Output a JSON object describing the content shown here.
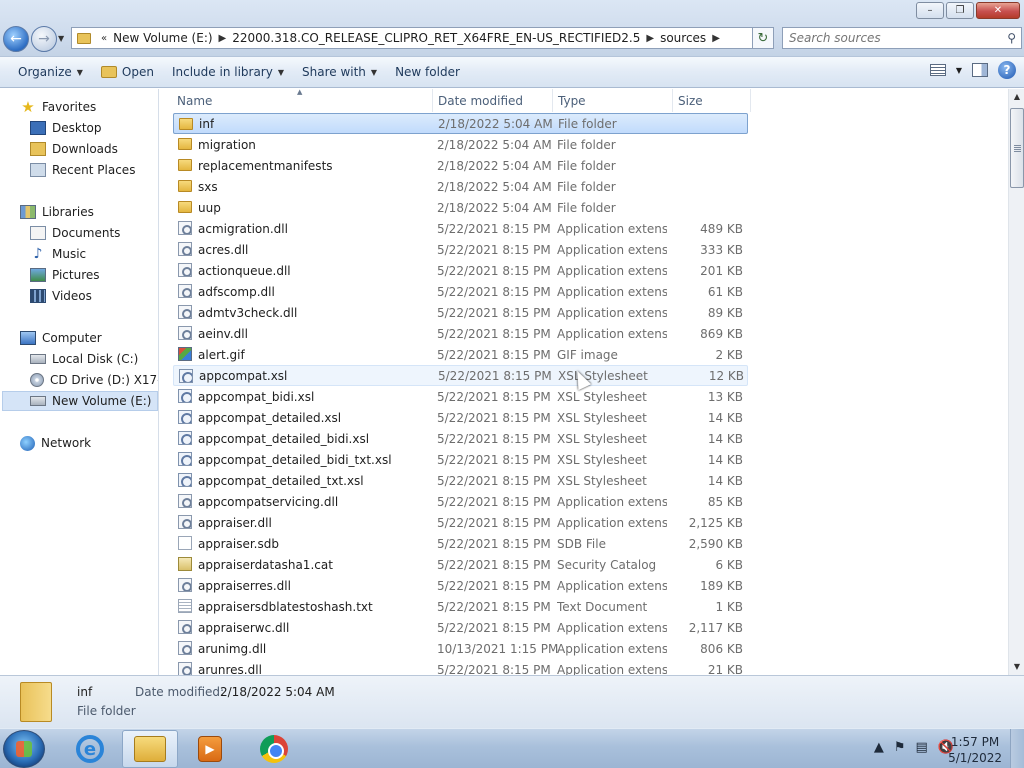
{
  "window": {
    "min_icon": "minimize-icon",
    "max_icon": "maximize-icon",
    "close_icon": "close-icon"
  },
  "address": {
    "crumbs": [
      "New Volume (E:)",
      "22000.318.CO_RELEASE_CLIPRO_RET_X64FRE_EN-US_RECTIFIED2.5",
      "sources"
    ],
    "overflow_glyph": "«"
  },
  "search": {
    "placeholder": "Search sources"
  },
  "toolbar": {
    "organize": "Organize",
    "open": "Open",
    "include_in_library": "Include in library",
    "share_with": "Share with",
    "new_folder": "New folder"
  },
  "nav": {
    "favorites": "Favorites",
    "desktop": "Desktop",
    "downloads": "Downloads",
    "recent_places": "Recent Places",
    "libraries": "Libraries",
    "documents": "Documents",
    "music": "Music",
    "pictures": "Pictures",
    "videos": "Videos",
    "computer": "Computer",
    "local_disk": "Local Disk (C:)",
    "cd_drive": "CD Drive (D:) X17-59",
    "new_volume": "New Volume (E:)",
    "network": "Network"
  },
  "columns": {
    "name": "Name",
    "date_modified": "Date modified",
    "type": "Type",
    "size": "Size"
  },
  "files": [
    {
      "name": "inf",
      "date": "2/18/2022 5:04 AM",
      "type": "File folder",
      "size": "",
      "icon": "folder-icon"
    },
    {
      "name": "migration",
      "date": "2/18/2022 5:04 AM",
      "type": "File folder",
      "size": "",
      "icon": "folder-icon"
    },
    {
      "name": "replacementmanifests",
      "date": "2/18/2022 5:04 AM",
      "type": "File folder",
      "size": "",
      "icon": "folder-icon"
    },
    {
      "name": "sxs",
      "date": "2/18/2022 5:04 AM",
      "type": "File folder",
      "size": "",
      "icon": "folder-icon"
    },
    {
      "name": "uup",
      "date": "2/18/2022 5:04 AM",
      "type": "File folder",
      "size": "",
      "icon": "folder-icon"
    },
    {
      "name": "acmigration.dll",
      "date": "5/22/2021 8:15 PM",
      "type": "Application extens...",
      "size": "489 KB",
      "icon": "dll-icon"
    },
    {
      "name": "acres.dll",
      "date": "5/22/2021 8:15 PM",
      "type": "Application extens...",
      "size": "333 KB",
      "icon": "dll-icon"
    },
    {
      "name": "actionqueue.dll",
      "date": "5/22/2021 8:15 PM",
      "type": "Application extens...",
      "size": "201 KB",
      "icon": "dll-icon"
    },
    {
      "name": "adfscomp.dll",
      "date": "5/22/2021 8:15 PM",
      "type": "Application extens...",
      "size": "61 KB",
      "icon": "dll-icon"
    },
    {
      "name": "admtv3check.dll",
      "date": "5/22/2021 8:15 PM",
      "type": "Application extens...",
      "size": "89 KB",
      "icon": "dll-icon"
    },
    {
      "name": "aeinv.dll",
      "date": "5/22/2021 8:15 PM",
      "type": "Application extens...",
      "size": "869 KB",
      "icon": "dll-icon"
    },
    {
      "name": "alert.gif",
      "date": "5/22/2021 8:15 PM",
      "type": "GIF image",
      "size": "2 KB",
      "icon": "gif-icon"
    },
    {
      "name": "appcompat.xsl",
      "date": "5/22/2021 8:15 PM",
      "type": "XSL Stylesheet",
      "size": "12 KB",
      "icon": "xsl-icon"
    },
    {
      "name": "appcompat_bidi.xsl",
      "date": "5/22/2021 8:15 PM",
      "type": "XSL Stylesheet",
      "size": "13 KB",
      "icon": "xsl-icon"
    },
    {
      "name": "appcompat_detailed.xsl",
      "date": "5/22/2021 8:15 PM",
      "type": "XSL Stylesheet",
      "size": "14 KB",
      "icon": "xsl-icon"
    },
    {
      "name": "appcompat_detailed_bidi.xsl",
      "date": "5/22/2021 8:15 PM",
      "type": "XSL Stylesheet",
      "size": "14 KB",
      "icon": "xsl-icon"
    },
    {
      "name": "appcompat_detailed_bidi_txt.xsl",
      "date": "5/22/2021 8:15 PM",
      "type": "XSL Stylesheet",
      "size": "14 KB",
      "icon": "xsl-icon"
    },
    {
      "name": "appcompat_detailed_txt.xsl",
      "date": "5/22/2021 8:15 PM",
      "type": "XSL Stylesheet",
      "size": "14 KB",
      "icon": "xsl-icon"
    },
    {
      "name": "appcompatservicing.dll",
      "date": "5/22/2021 8:15 PM",
      "type": "Application extens...",
      "size": "85 KB",
      "icon": "dll-icon"
    },
    {
      "name": "appraiser.dll",
      "date": "5/22/2021 8:15 PM",
      "type": "Application extens...",
      "size": "2,125 KB",
      "icon": "dll-icon"
    },
    {
      "name": "appraiser.sdb",
      "date": "5/22/2021 8:15 PM",
      "type": "SDB File",
      "size": "2,590 KB",
      "icon": "file-icon"
    },
    {
      "name": "appraiserdatasha1.cat",
      "date": "5/22/2021 8:15 PM",
      "type": "Security Catalog",
      "size": "6 KB",
      "icon": "catalog-icon"
    },
    {
      "name": "appraiserres.dll",
      "date": "5/22/2021 8:15 PM",
      "type": "Application extens...",
      "size": "189 KB",
      "icon": "dll-icon"
    },
    {
      "name": "appraisersdblatestoshash.txt",
      "date": "5/22/2021 8:15 PM",
      "type": "Text Document",
      "size": "1 KB",
      "icon": "text-file-icon"
    },
    {
      "name": "appraiserwc.dll",
      "date": "5/22/2021 8:15 PM",
      "type": "Application extens...",
      "size": "2,117 KB",
      "icon": "dll-icon"
    },
    {
      "name": "arunimg.dll",
      "date": "10/13/2021 1:15 PM",
      "type": "Application extens...",
      "size": "806 KB",
      "icon": "dll-icon"
    },
    {
      "name": "arunres.dll",
      "date": "5/22/2021 8:15 PM",
      "type": "Application extens...",
      "size": "21 KB",
      "icon": "dll-icon"
    }
  ],
  "details": {
    "name": "inf",
    "type": "File folder",
    "date_label": "Date modified:",
    "date": "2/18/2022 5:04 AM"
  },
  "taskbar": {
    "apps": [
      "internet-explorer-icon",
      "windows-explorer-icon",
      "media-player-icon",
      "chrome-icon"
    ],
    "time": "1:57 PM",
    "date": "5/1/2022"
  }
}
